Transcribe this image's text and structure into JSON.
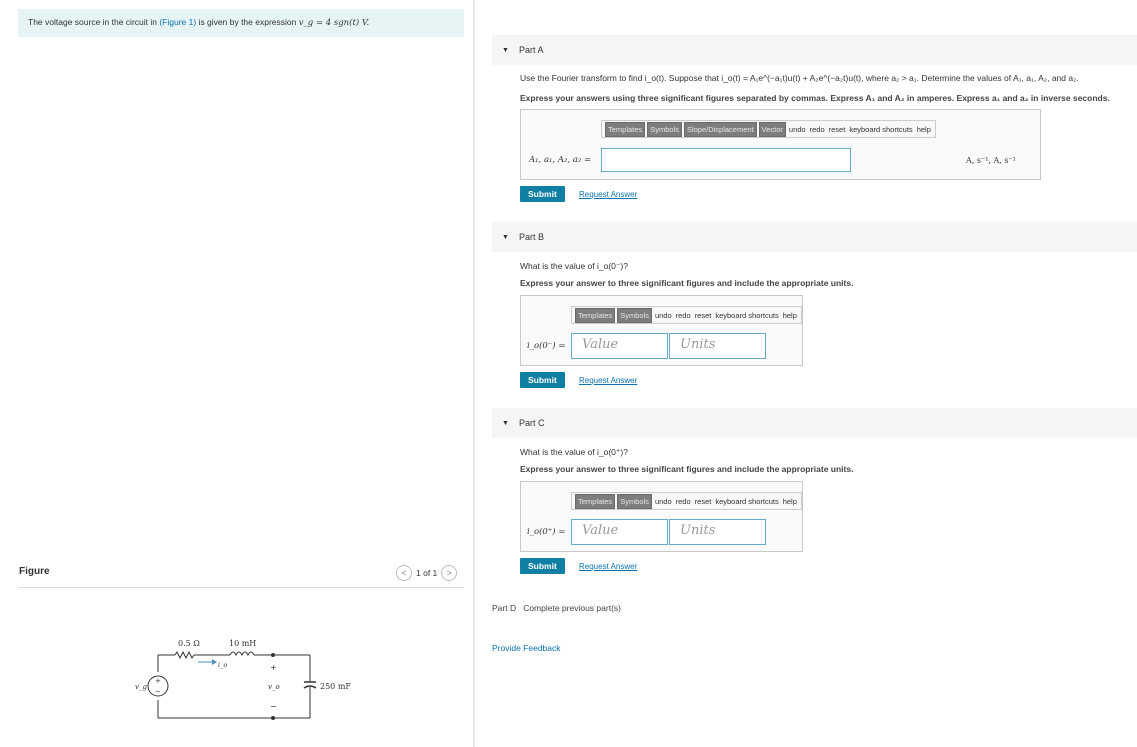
{
  "intro": {
    "prefix": "The voltage source in the circuit in ",
    "figure_link": "(Figure 1)",
    "middle": " is given by the expression ",
    "expression": "v_g = 4 sgn(t) V."
  },
  "figure": {
    "label": "Figure",
    "pager": "1 of 1",
    "prev": "<",
    "next": ">",
    "circuit": {
      "resistor": "0.5 Ω",
      "inductor": "10 mH",
      "capacitor": "250 mF",
      "source": "v_g",
      "current": "i_o",
      "output": "v_o",
      "plus": "+",
      "minus": "−"
    }
  },
  "toolbar": {
    "templates": "Templates",
    "symbols": "Symbols",
    "slope": "Slope/Displacement",
    "vector": "Vector",
    "undo": "undo",
    "redo": "redo",
    "reset": "reset",
    "shortcuts": "keyboard shortcuts",
    "help": "help"
  },
  "partA": {
    "title": "Part A",
    "question": "Use the Fourier transform to find i_o(t). Suppose that i_o(t) = A₁e^(−a₁t)u(t) + A₂e^(−a₂t)u(t), where a₂ > a₁. Determine the values of A₁, a₁, A₂, and a₂.",
    "instructions": "Express your answers using three significant figures separated by commas. Express A₁ and A₂ in amperes. Express a₁ and a₂ in inverse seconds.",
    "eq_label": "A₁, a₁, A₂, a₂ =",
    "units": "A, s⁻¹, A, s⁻¹",
    "submit": "Submit",
    "request": "Request Answer"
  },
  "partB": {
    "title": "Part B",
    "question": "What is the value of i_o(0⁻)?",
    "instructions": "Express your answer to three significant figures and include the appropriate units.",
    "eq_label": "i_o(0⁻) =",
    "value_placeholder": "Value",
    "units_placeholder": "Units",
    "submit": "Submit",
    "request": "Request Answer"
  },
  "partC": {
    "title": "Part C",
    "question": "What is the value of i_o(0⁺)?",
    "instructions": "Express your answer to three significant figures and include the appropriate units.",
    "eq_label": "i_o(0⁺) =",
    "value_placeholder": "Value",
    "units_placeholder": "Units",
    "submit": "Submit",
    "request": "Request Answer"
  },
  "partD": {
    "title": "Part D",
    "status": "Complete previous part(s)"
  },
  "feedback": "Provide Feedback"
}
